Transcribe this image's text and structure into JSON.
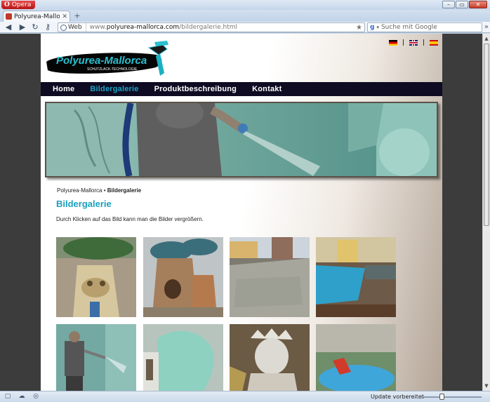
{
  "browser": {
    "menu_label": "Opera",
    "tab_title": "Polyurea-Mallorca: Bild...",
    "address": {
      "mode": "Web",
      "url_prefix": "www.",
      "url_domain": "polyurea-mallorca.com",
      "url_path": "/bildergalerie.html"
    },
    "search_placeholder": "Suche mit Google",
    "status_text": "Update vorbereitet"
  },
  "site": {
    "logo_text": "Polyurea-Mallorca",
    "logo_tagline": "SCHUTZLACK-TECHNOLOGIE",
    "flags": [
      "de-flag",
      "en-flag",
      "es-flag"
    ],
    "nav": [
      {
        "label": "Home",
        "active": false
      },
      {
        "label": "Bildergalerie",
        "active": true
      },
      {
        "label": "Produktbeschreibung",
        "active": false
      },
      {
        "label": "Kontakt",
        "active": false
      }
    ],
    "breadcrumb": {
      "root": "Polyurea-Mallorca",
      "separator": "•",
      "current": "Bildergalerie"
    },
    "heading": "Bildergalerie",
    "intro": "Durch Klicken auf das Bild kann man die Bilder vergrößern.",
    "thumbnails": [
      "tree-sculpture-photo",
      "tree-house-photo",
      "pool-construction-photo",
      "pool-finished-photo",
      "spraying-worker-photo",
      "sculpture-spraying-photo",
      "statue-of-liberty-photo",
      "playground-pool-photo"
    ]
  },
  "colors": {
    "nav_bg": "#0e0b22",
    "accent": "#1aa3c4",
    "browser_chrome": "#c9d9ea"
  }
}
